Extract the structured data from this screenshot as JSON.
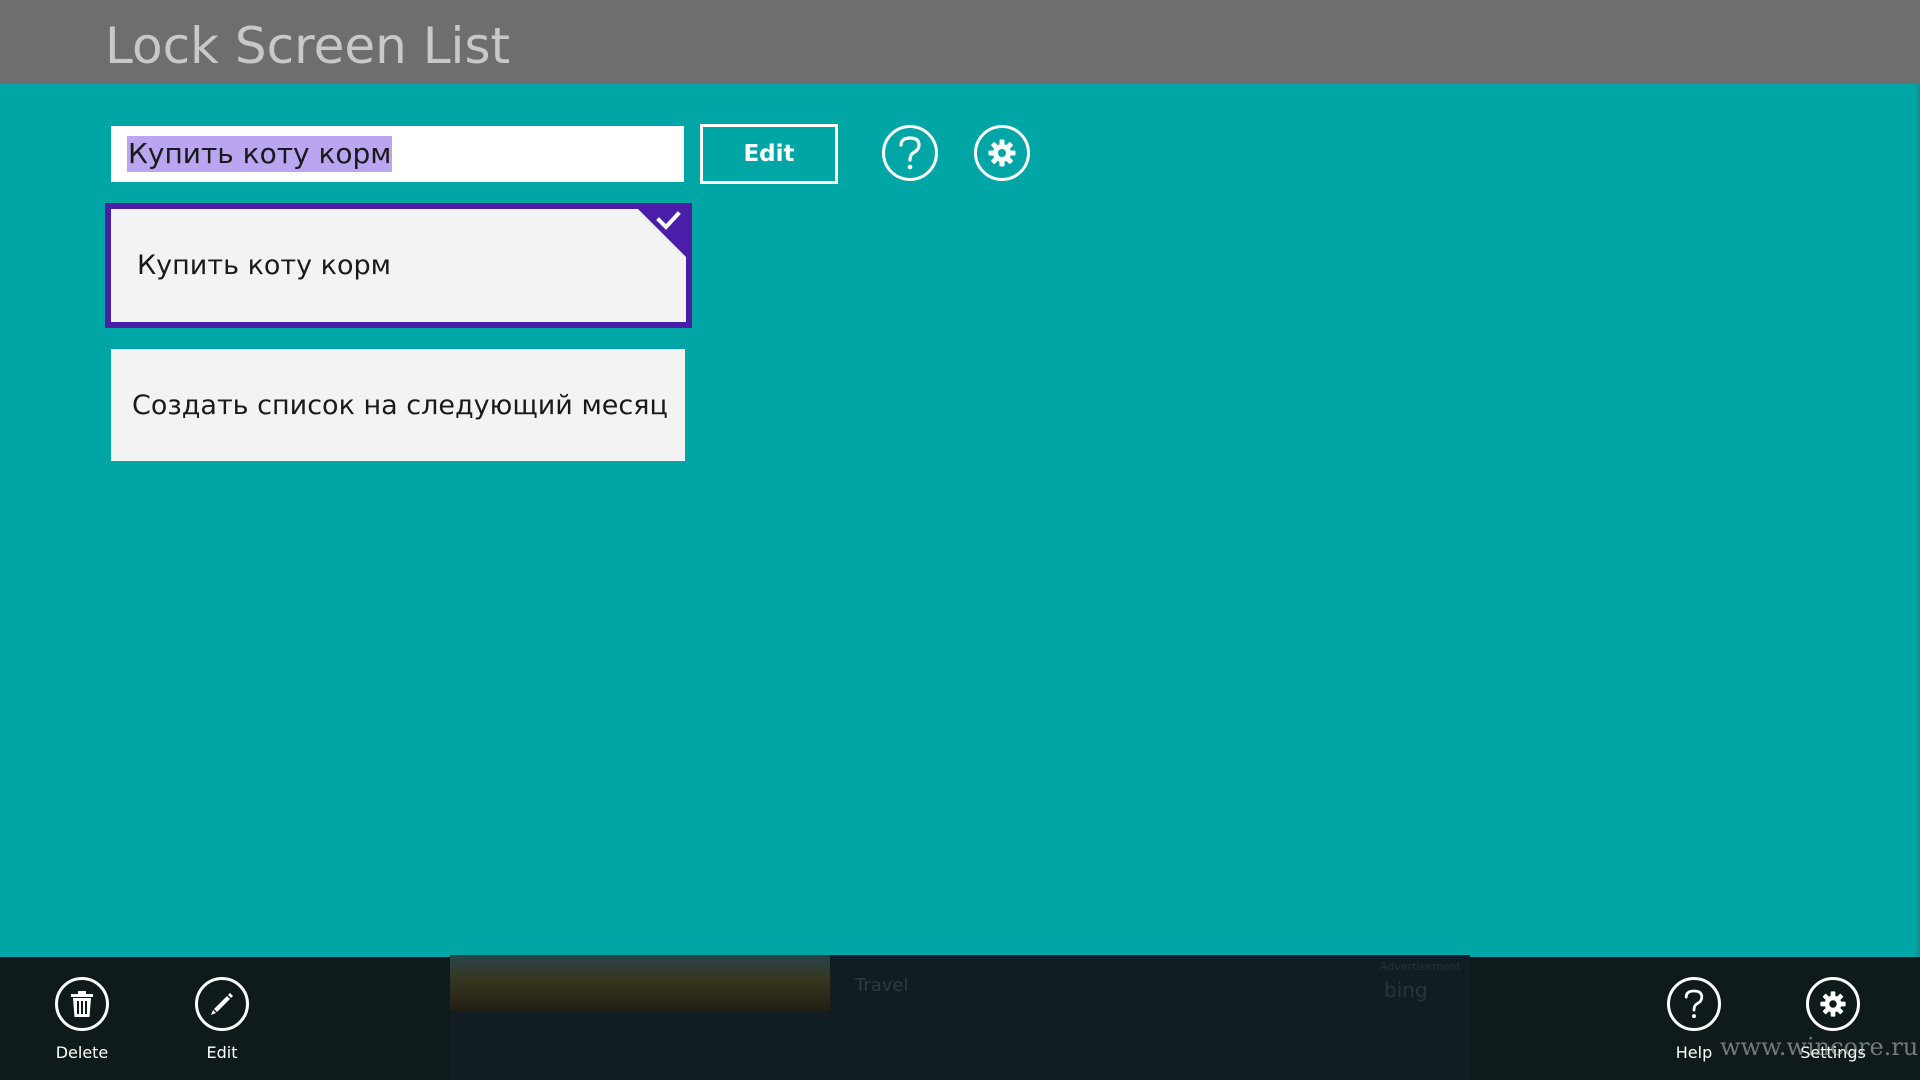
{
  "app": {
    "title": "Lock Screen List"
  },
  "editor": {
    "input_value": "Купить коту корм",
    "edit_label": "Edit",
    "help_icon": "question-circle-icon",
    "settings_icon": "gear-icon"
  },
  "list": {
    "items": [
      {
        "label": "Купить коту корм",
        "selected": true
      },
      {
        "label": "Создать список на следующий месяц",
        "selected": false
      }
    ]
  },
  "appbar": {
    "delete_label": "Delete",
    "edit_label": "Edit",
    "help_label": "Help",
    "settings_label": "Settings"
  },
  "ad": {
    "category": "Travel",
    "brand": "bing",
    "label": "Advertisement"
  },
  "watermark": "www.wincore.ru",
  "colors": {
    "background": "#00A6A6",
    "titlebar": "#6E6E6E",
    "selection_border": "#4B1EAA",
    "appbar": "#0F1A1B"
  }
}
